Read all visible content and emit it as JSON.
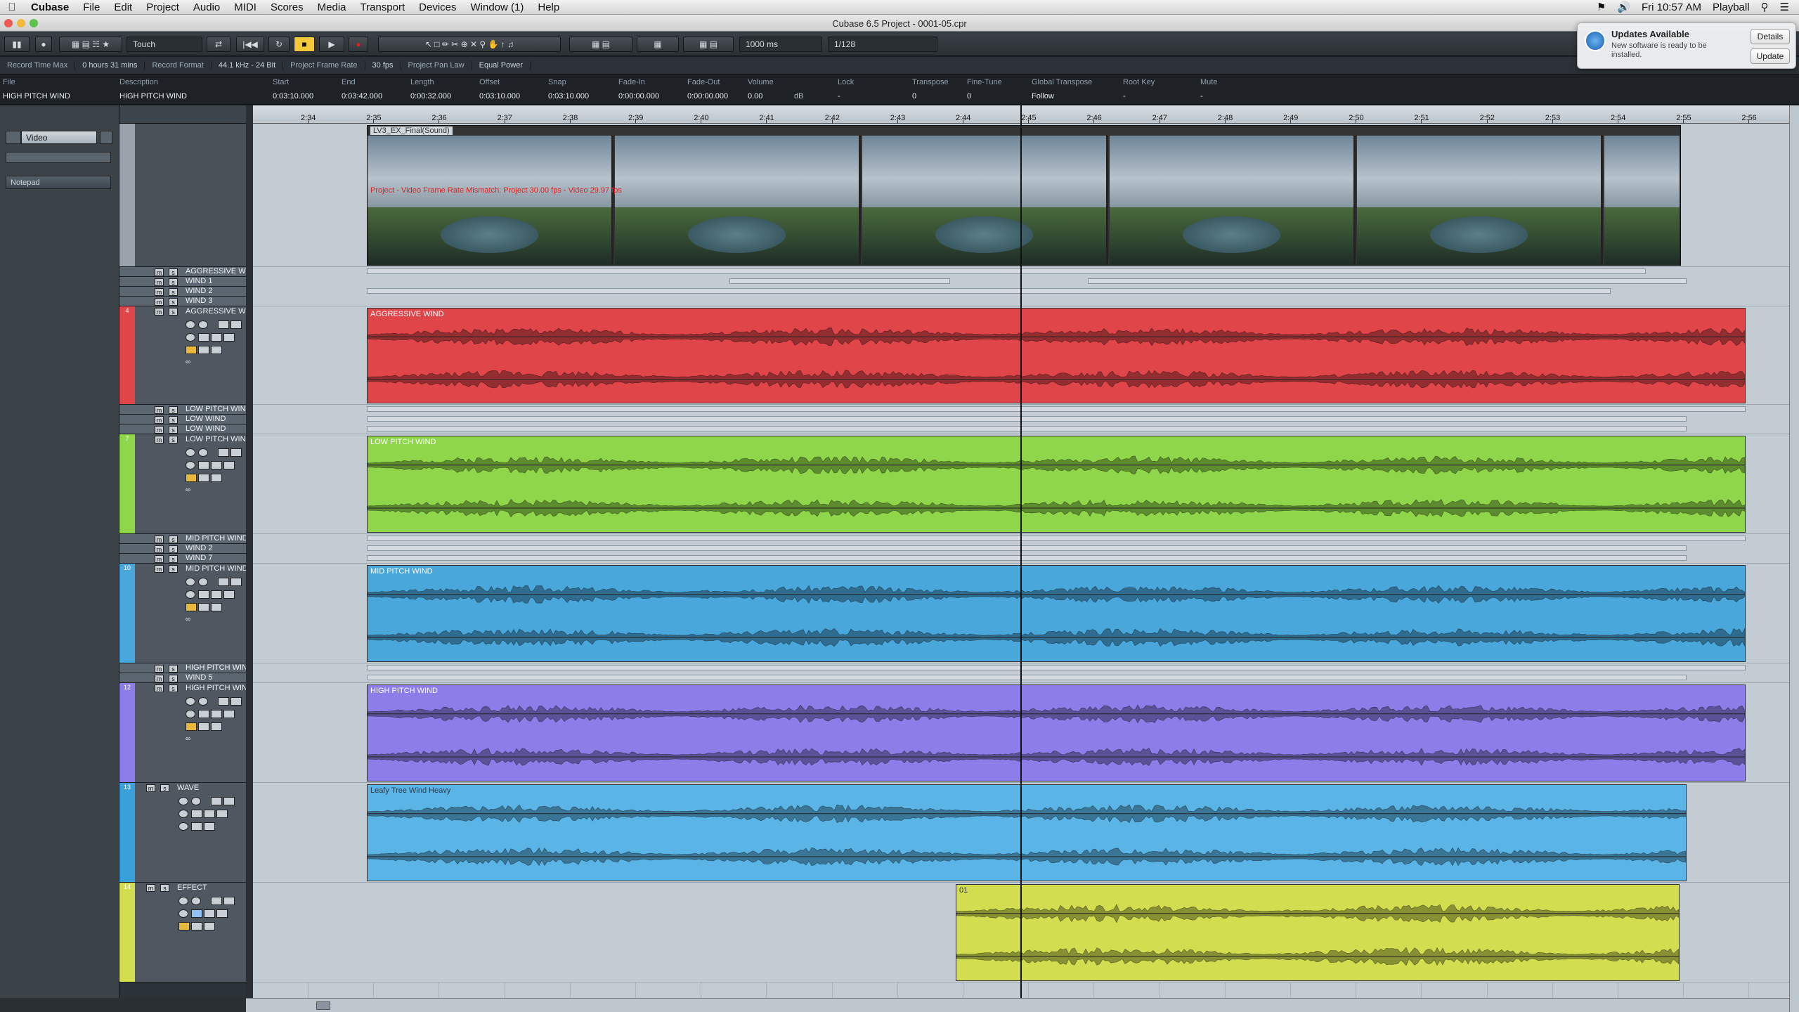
{
  "menubar": {
    "app": "Cubase",
    "items": [
      "File",
      "Edit",
      "Project",
      "Audio",
      "MIDI",
      "Scores",
      "Media",
      "Transport",
      "Devices",
      "Window (1)",
      "Help"
    ],
    "clock": "Fri 10:57 AM",
    "user": "Playball"
  },
  "window": {
    "title": "Cubase 6.5 Project - 0001-05.cpr"
  },
  "toolbar": {
    "automation_mode": "Touch",
    "nudge": "1000 ms",
    "quantize": "1/128"
  },
  "status": {
    "record_time_label": "Record Time Max",
    "record_time_value": "0 hours 31 mins",
    "record_format_label": "Record Format",
    "record_format_value": "44.1 kHz - 24 Bit",
    "frame_rate_label": "Project Frame Rate",
    "frame_rate_value": "30 fps",
    "pan_law_label": "Project Pan Law",
    "pan_law_value": "Equal Power"
  },
  "infoline": {
    "file_label": "File",
    "file_value": "HIGH PITCH WIND",
    "desc_label": "Description",
    "desc_value": "HIGH PITCH WIND",
    "start_label": "Start",
    "start_value": "0:03:10.000",
    "end_label": "End",
    "end_value": "0:03:42.000",
    "length_label": "Length",
    "length_value": "0:00:32.000",
    "offset_label": "Offset",
    "offset_value": "0:03:10.000",
    "snap_label": "Snap",
    "snap_value": "0:03:10.000",
    "fadein_label": "Fade-In",
    "fadein_value": "0:00:00.000",
    "fadeout_label": "Fade-Out",
    "fadeout_value": "0:00:00.000",
    "volume_label": "Volume",
    "volume_value": "0.00",
    "volume_unit": "dB",
    "lock_label": "Lock",
    "lock_value": "-",
    "transpose_label": "Transpose",
    "transpose_value": "0",
    "finetune_label": "Fine-Tune",
    "finetune_value": "0",
    "globaltranspose_label": "Global Transpose",
    "globaltranspose_value": "Follow",
    "rootkey_label": "Root Key",
    "rootkey_value": "-",
    "mute_label": "Mute",
    "mute_value": "-"
  },
  "inspector": {
    "video_label": "Video",
    "notepad_label": "Notepad"
  },
  "ruler": [
    "2:34",
    "2:35",
    "2:36",
    "2:37",
    "2:38",
    "2:39",
    "2:40",
    "2:41",
    "2:42",
    "2:43",
    "2:44",
    "2:45",
    "2:46",
    "2:47",
    "2:48",
    "2:49",
    "2:50",
    "2:51",
    "2:52",
    "2:53",
    "2:54",
    "2:55",
    "2:56"
  ],
  "video": {
    "clip_label": "LV3_EX_Final(Sound)",
    "warning": "Project - Video Frame Rate Mismatch: Project 30.00 fps - Video 29.97 fps"
  },
  "tracks": {
    "t1": {
      "folder": "AGGRESSIVE WIND",
      "subs": [
        "WIND 1",
        "WIND 2",
        "WIND 3"
      ],
      "main": "AGGRESSIVE WIND",
      "num": "4",
      "event": "AGGRESSIVE WIND",
      "color": "#e0454a"
    },
    "t2": {
      "folder": "LOW PITCH WIND",
      "subs": [
        "LOW WIND",
        "LOW WIND"
      ],
      "main": "LOW PITCH WIND",
      "num": "7",
      "event": "LOW PITCH WIND",
      "color": "#8fd64a"
    },
    "t3": {
      "folder": "MID PITCH WIND",
      "subs": [
        "WIND 2",
        "WIND 7"
      ],
      "main": "MID PITCH WIND",
      "num": "10",
      "event": "MID PITCH WIND",
      "color": "#4aa7dc"
    },
    "t4": {
      "folder": "HIGH PITCH WIND",
      "subs": [
        "WIND 5"
      ],
      "main": "HIGH PITCH WIND",
      "num": "12",
      "event": "HIGH PITCH WIND",
      "color": "#8d7de8"
    },
    "t5": {
      "main": "WAVE",
      "num": "13",
      "event": "Leafy Tree Wind Heavy",
      "color": "#5ab4e6"
    },
    "t6": {
      "main": "EFFECT",
      "num": "14",
      "event": "01",
      "color": "#d2de50"
    }
  },
  "notification": {
    "title": "Updates Available",
    "message": "New software is ready to be installed.",
    "details": "Details",
    "update": "Update"
  }
}
